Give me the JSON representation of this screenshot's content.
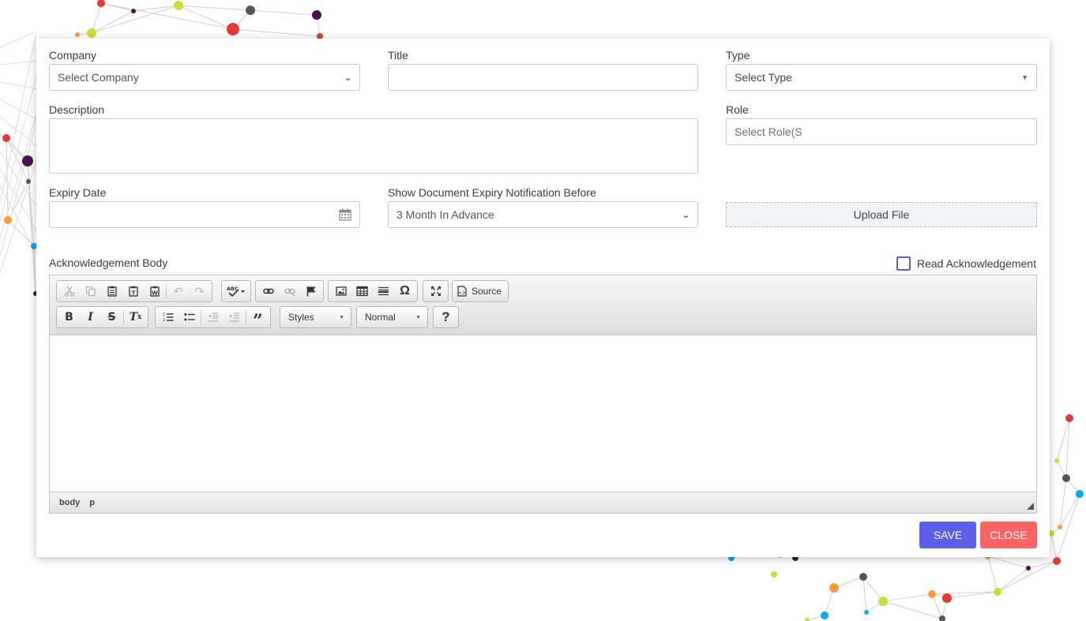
{
  "form": {
    "company": {
      "label": "Company",
      "value": "Select Company"
    },
    "title": {
      "label": "Title",
      "value": ""
    },
    "type": {
      "label": "Type",
      "value": "Select Type"
    },
    "description": {
      "label": "Description",
      "value": ""
    },
    "role": {
      "label": "Role",
      "placeholder": "Select Role(S"
    },
    "expiry_date": {
      "label": "Expiry Date",
      "value": ""
    },
    "notification": {
      "label": "Show Document Expiry Notification Before",
      "value": "3 Month In Advance"
    },
    "upload_label": "Upload File",
    "ack_label": "Acknowledgement Body",
    "read_ack_label": "Read Acknowledgement",
    "read_ack_checked": false
  },
  "editor": {
    "source_label": "Source",
    "styles_label": "Styles",
    "format_label": "Normal",
    "help_label": "?",
    "status_path": [
      "body",
      "p"
    ]
  },
  "actions": {
    "save_label": "SAVE",
    "close_label": "CLOSE",
    "save_color": "#5a5ee8",
    "close_color": "#ff6464"
  },
  "icons": {
    "toolbar_row1": [
      "cut-icon",
      "copy-icon",
      "paste-icon",
      "paste-text-icon",
      "paste-word-icon",
      "undo-icon",
      "redo-icon",
      "spellcheck-icon",
      "link-icon",
      "unlink-icon",
      "anchor-icon",
      "image-icon",
      "table-icon",
      "horizontal-rule-icon",
      "special-char-icon",
      "maximize-icon",
      "source-icon"
    ],
    "toolbar_row2": [
      "bold-icon",
      "italic-icon",
      "strike-icon",
      "remove-format-icon",
      "numbered-list-icon",
      "bulleted-list-icon",
      "outdent-icon",
      "indent-icon",
      "blockquote-icon",
      "help-icon"
    ],
    "date_field": "calendar-icon"
  }
}
